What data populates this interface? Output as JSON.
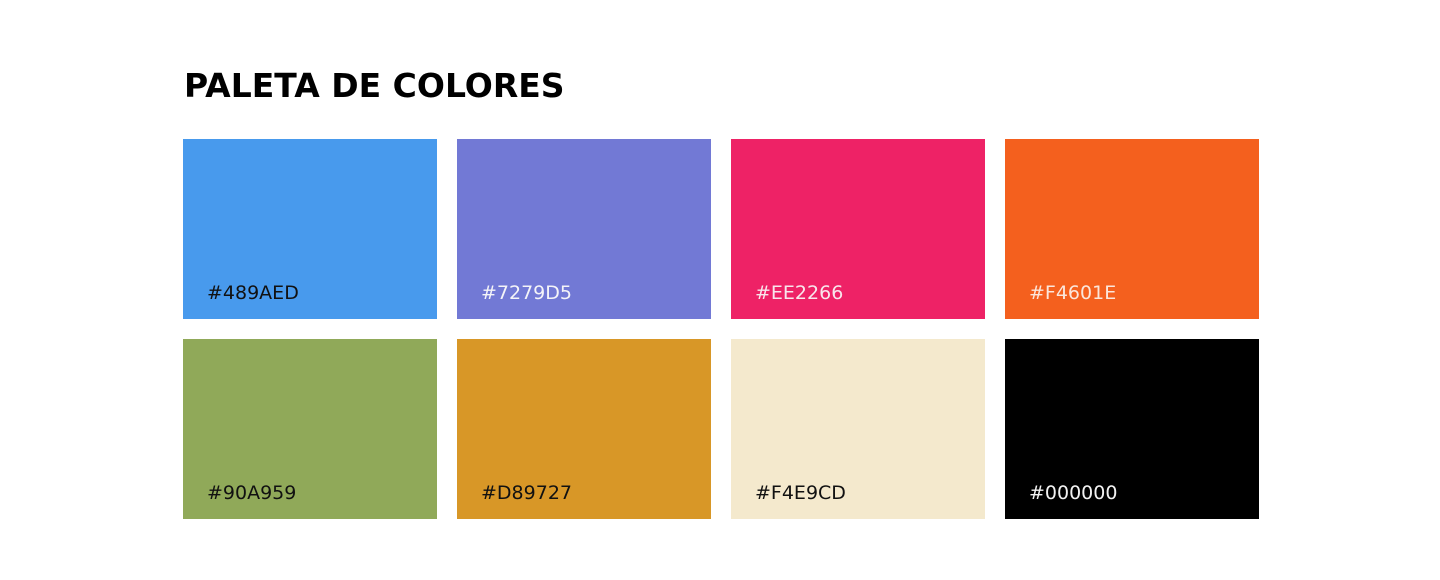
{
  "title": "PALETA DE COLORES",
  "swatches": [
    {
      "code": "#489AED",
      "color": "#489AED",
      "text_color": "#111111"
    },
    {
      "code": "#7279D5",
      "color": "#7279D5",
      "text_color": "#F4F4F8"
    },
    {
      "code": "#EE2266",
      "color": "#EE2266",
      "text_color": "#F8E6EC"
    },
    {
      "code": "#F4601E",
      "color": "#F4601E",
      "text_color": "#FBE6DB"
    },
    {
      "code": "#90A959",
      "color": "#90A959",
      "text_color": "#111111"
    },
    {
      "code": "#D89727",
      "color": "#D89727",
      "text_color": "#111111"
    },
    {
      "code": "#F4E9CD",
      "color": "#F4E9CD",
      "text_color": "#111111"
    },
    {
      "code": "#000000",
      "color": "#000000",
      "text_color": "#F2F2F2"
    }
  ]
}
